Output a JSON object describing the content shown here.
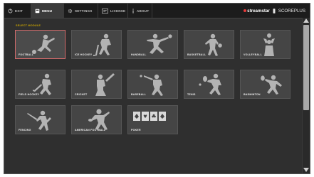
{
  "topbar": {
    "tabs": [
      {
        "label": "EXIT",
        "icon": "exit-icon",
        "active": false
      },
      {
        "label": "MENU",
        "icon": "menu-icon",
        "active": true
      },
      {
        "label": "SETTINGS",
        "icon": "gear-icon",
        "active": false
      },
      {
        "label": "LICENSE",
        "icon": "license-icon",
        "active": false
      },
      {
        "label": "ABOUT",
        "icon": "info-icon",
        "active": false
      }
    ],
    "brand": {
      "primary": "streamstar",
      "secondary": "SCOREPLUS"
    }
  },
  "panel": {
    "title": "SELECT MODULE"
  },
  "sports": [
    {
      "label": "FOOTBALL",
      "selected": true,
      "icon": "football-player-icon"
    },
    {
      "label": "ICE HOCKEY",
      "selected": false,
      "icon": "ice-hockey-player-icon"
    },
    {
      "label": "HANDBALL",
      "selected": false,
      "icon": "handball-player-icon"
    },
    {
      "label": "BASKETBALL",
      "selected": false,
      "icon": "basketball-player-icon"
    },
    {
      "label": "VOLLEYBALL",
      "selected": false,
      "icon": "volleyball-player-icon"
    },
    {
      "label": "FIELD HOCKEY",
      "selected": false,
      "icon": "field-hockey-player-icon"
    },
    {
      "label": "CRICKET",
      "selected": false,
      "icon": "cricket-player-icon"
    },
    {
      "label": "BASEBALL",
      "selected": false,
      "icon": "baseball-player-icon"
    },
    {
      "label": "TENIS",
      "selected": false,
      "icon": "tennis-player-icon"
    },
    {
      "label": "BADMINTON",
      "selected": false,
      "icon": "badminton-player-icon"
    },
    {
      "label": "FENCING",
      "selected": false,
      "icon": "fencing-player-icon"
    },
    {
      "label": "AMERICAN FOOTBALL",
      "selected": false,
      "icon": "american-football-player-icon"
    },
    {
      "label": "POKER",
      "selected": false,
      "icon": "poker-cards-icon"
    }
  ],
  "colors": {
    "accent": "#d36a6a",
    "title": "#c9a400",
    "brand_dot": "#e63a3a",
    "background": "#2f2f2f",
    "card": "#454545"
  }
}
